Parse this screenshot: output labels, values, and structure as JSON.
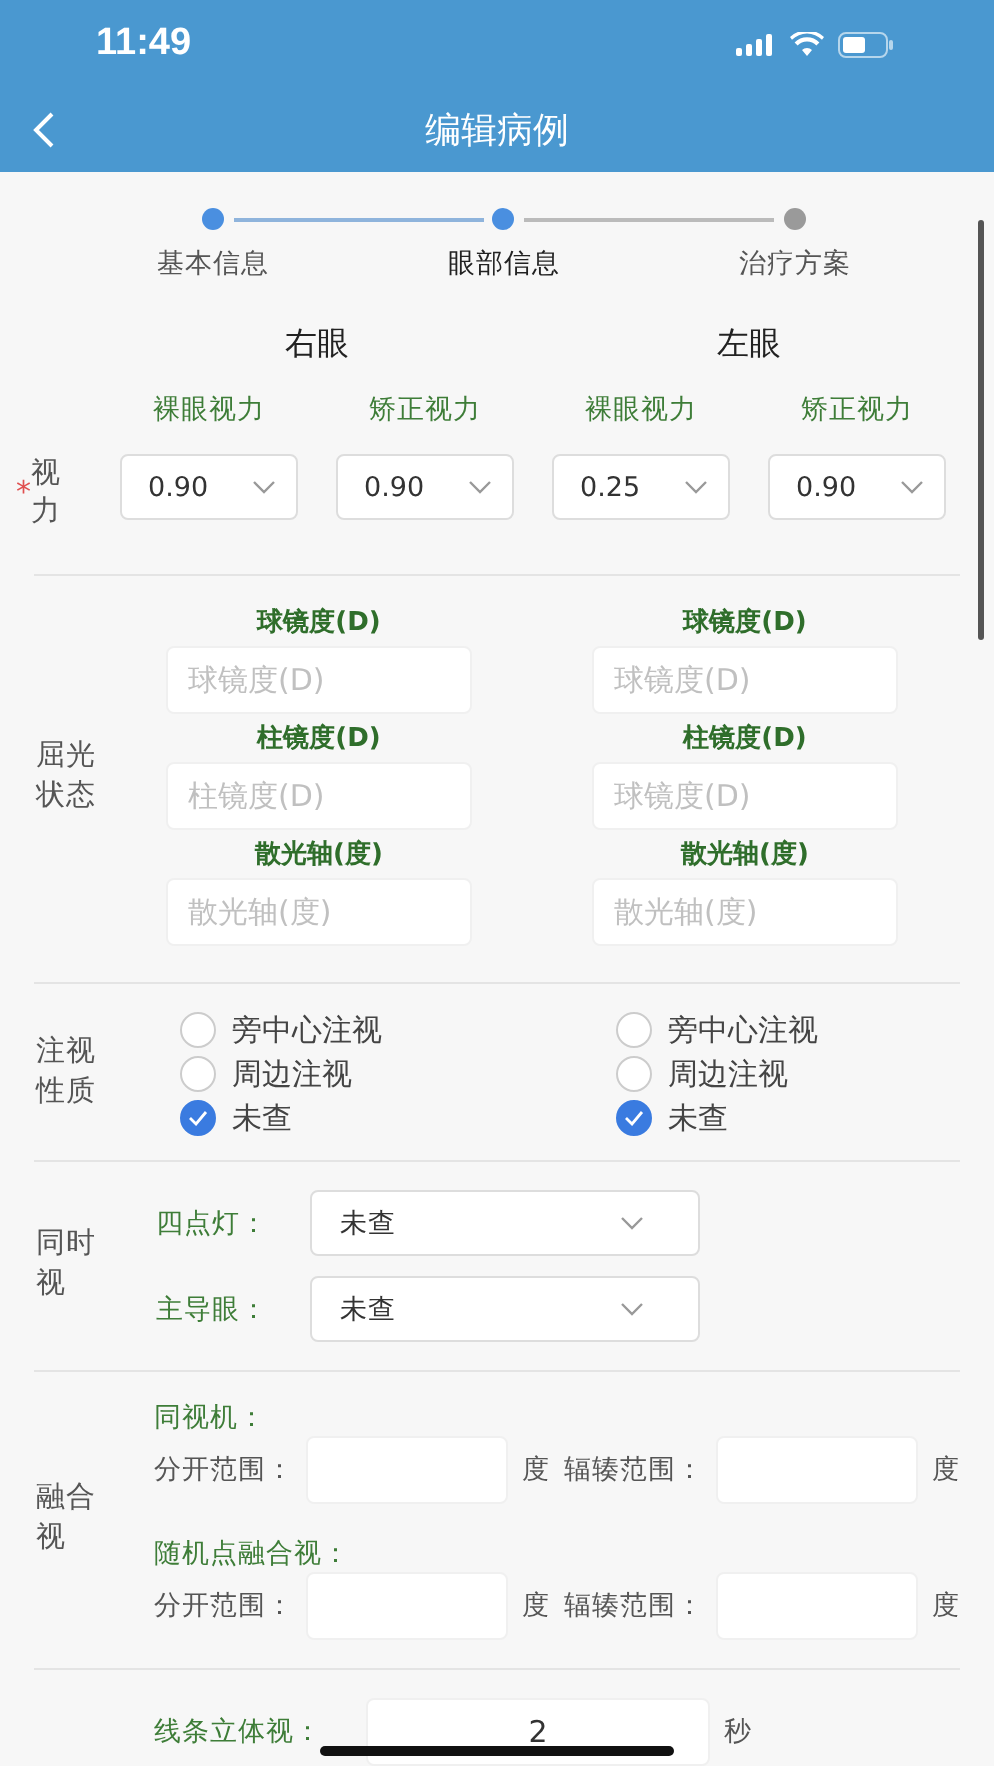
{
  "status_bar": {
    "time": "11:49"
  },
  "nav_bar": {
    "title": "编辑病例"
  },
  "steps": [
    {
      "label": "基本信息",
      "done": true,
      "selected": false
    },
    {
      "label": "眼部信息",
      "done": true,
      "selected": true
    },
    {
      "label": "治疗方案",
      "done": false,
      "selected": false
    }
  ],
  "visual_acuity": {
    "label": "视力",
    "required_mark": "*",
    "eyes": [
      {
        "title": "右眼",
        "fields": [
          {
            "label": "裸眼视力",
            "value": "0.90"
          },
          {
            "label": "矫正视力",
            "value": "0.90"
          }
        ]
      },
      {
        "title": "左眼",
        "fields": [
          {
            "label": "裸眼视力",
            "value": "0.25"
          },
          {
            "label": "矫正视力",
            "value": "0.90"
          }
        ]
      }
    ]
  },
  "refraction": {
    "label": "屈光状态",
    "eyes": [
      {
        "fields": [
          {
            "label": "球镜度(D)",
            "placeholder": "球镜度(D)"
          },
          {
            "label": "柱镜度(D)",
            "placeholder": "柱镜度(D)"
          },
          {
            "label": "散光轴(度)",
            "placeholder": "散光轴(度)"
          }
        ]
      },
      {
        "fields": [
          {
            "label": "球镜度(D)",
            "placeholder": "球镜度(D)"
          },
          {
            "label": "柱镜度(D)",
            "placeholder": "球镜度(D)"
          },
          {
            "label": "散光轴(度)",
            "placeholder": "散光轴(度)"
          }
        ]
      }
    ]
  },
  "fixation": {
    "label": "注视性质",
    "eyes": [
      {
        "options": [
          {
            "label": "旁中心注视",
            "selected": false
          },
          {
            "label": "周边注视",
            "selected": false
          },
          {
            "label": "未查",
            "selected": true
          }
        ]
      },
      {
        "options": [
          {
            "label": "旁中心注视",
            "selected": false
          },
          {
            "label": "周边注视",
            "selected": false
          },
          {
            "label": "未查",
            "selected": true
          }
        ]
      }
    ]
  },
  "simultaneous": {
    "label": "同时视",
    "rows": [
      {
        "label": "四点灯：",
        "value": "未查"
      },
      {
        "label": "主导眼：",
        "value": "未查"
      }
    ]
  },
  "fusion": {
    "label": "融合视",
    "groups": [
      {
        "title": "同视机：",
        "fields": [
          {
            "label": "分开范围：",
            "unit": "度"
          },
          {
            "label": "辐辏范围：",
            "unit": "度"
          }
        ]
      },
      {
        "title": "随机点融合视：",
        "fields": [
          {
            "label": "分开范围：",
            "unit": "度"
          },
          {
            "label": "辐辏范围：",
            "unit": "度"
          }
        ]
      }
    ]
  },
  "stereo": {
    "rows": [
      {
        "label": "线条立体视：",
        "value": "2",
        "unit": "秒"
      }
    ]
  }
}
